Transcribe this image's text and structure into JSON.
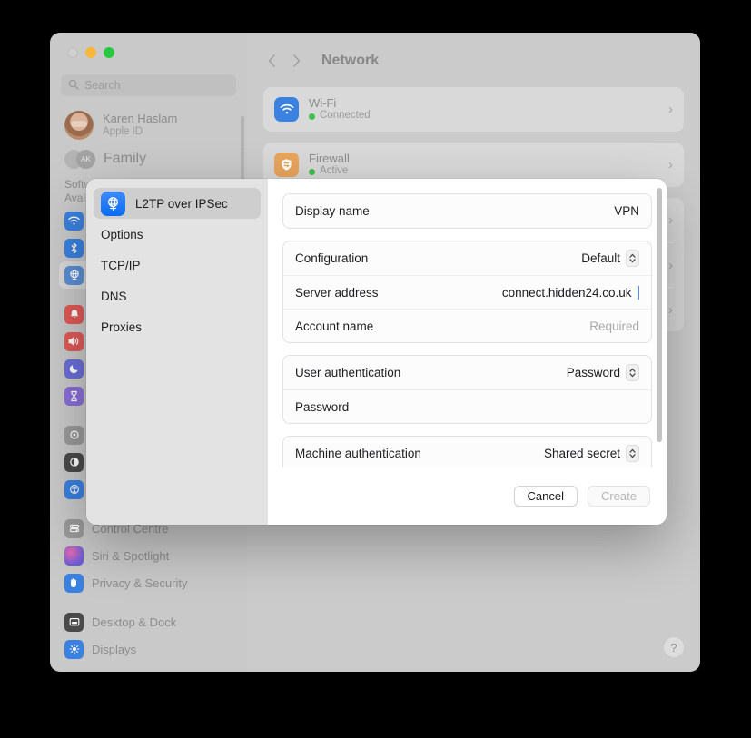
{
  "window": {
    "traffic_lights": [
      "close",
      "minimize",
      "maximize"
    ],
    "sidebar": {
      "search_placeholder": "Search",
      "account": {
        "name": "Karen Haslam",
        "subtitle": "Apple ID"
      },
      "family_label": "Family",
      "family_badge": "AK",
      "software_update_line1": "Software Update",
      "software_update_line2": "Available",
      "items": [
        {
          "label": "Wi-Fi",
          "icon": "wifi-icon",
          "color": "#3b82e0",
          "selected": false
        },
        {
          "label": "Bluetooth",
          "icon": "bluetooth-icon",
          "color": "#3b82e0",
          "selected": false
        },
        {
          "label": "Network",
          "icon": "globe-icon",
          "color": "#5b8fd4",
          "selected": true
        },
        {
          "label": "Notifications",
          "icon": "bell-icon",
          "color": "#e05a57",
          "selected": false
        },
        {
          "label": "Sound",
          "icon": "speaker-icon",
          "color": "#e05a57",
          "selected": false
        },
        {
          "label": "Focus",
          "icon": "moon-icon",
          "color": "#6b6fd8",
          "selected": false
        },
        {
          "label": "Screen Time",
          "icon": "hourglass-icon",
          "color": "#8a6fd8",
          "selected": false
        },
        {
          "label": "General",
          "icon": "gear-icon",
          "color": "#9a9a9a",
          "selected": false
        },
        {
          "label": "Appearance",
          "icon": "contrast-icon",
          "color": "#4a4a4a",
          "selected": false
        },
        {
          "label": "Accessibility",
          "icon": "accessibility-icon",
          "color": "#3b82e0",
          "selected": false
        },
        {
          "label": "Control Centre",
          "icon": "control-centre-icon",
          "color": "#9a9a9a",
          "selected": false
        },
        {
          "label": "Siri & Spotlight",
          "icon": "siri-icon",
          "color": "#c050a0",
          "selected": false
        },
        {
          "label": "Privacy & Security",
          "icon": "hand-icon",
          "color": "#3b82e0",
          "selected": false
        },
        {
          "label": "Desktop & Dock",
          "icon": "desktop-icon",
          "color": "#4a4a4a",
          "selected": false
        },
        {
          "label": "Displays",
          "icon": "display-icon",
          "color": "#3b82e0",
          "selected": false
        }
      ]
    },
    "detail": {
      "title": "Network",
      "back_icon": "chevron-left-icon",
      "forward_icon": "chevron-right-icon",
      "services": [
        {
          "name": "Wi-Fi",
          "status": "Connected",
          "icon": "wifi-icon",
          "color": "#3b82e0",
          "status_color": "#3fbf50"
        },
        {
          "name": "Firewall",
          "status": "Active",
          "icon": "firewall-icon",
          "color": "#e8a55c",
          "status_color": "#3fbf50"
        }
      ],
      "help_label": "?"
    }
  },
  "sheet": {
    "sidebar": {
      "protocol": {
        "label": "L2TP over IPSec",
        "icon": "vpn-globe-icon"
      },
      "items": [
        {
          "label": "Options"
        },
        {
          "label": "TCP/IP"
        },
        {
          "label": "DNS"
        },
        {
          "label": "Proxies"
        }
      ]
    },
    "form": {
      "groups": [
        {
          "rows": [
            {
              "label": "Display name",
              "value": "VPN",
              "type": "text",
              "placeholder": false,
              "caret": false,
              "cursor": false
            }
          ]
        },
        {
          "rows": [
            {
              "label": "Configuration",
              "value": "Default",
              "type": "popup",
              "placeholder": false,
              "caret": true,
              "cursor": false
            },
            {
              "label": "Server address",
              "value": "connect.hidden24.co.uk",
              "type": "text",
              "placeholder": false,
              "caret": false,
              "cursor": true
            },
            {
              "label": "Account name",
              "value": "Required",
              "type": "text",
              "placeholder": true,
              "caret": false,
              "cursor": false
            }
          ]
        },
        {
          "rows": [
            {
              "label": "User authentication",
              "value": "Password",
              "type": "popup",
              "placeholder": false,
              "caret": true,
              "cursor": false
            },
            {
              "label": "Password",
              "value": "",
              "type": "text",
              "placeholder": false,
              "caret": false,
              "cursor": false
            }
          ]
        },
        {
          "rows": [
            {
              "label": "Machine authentication",
              "value": "Shared secret",
              "type": "popup",
              "placeholder": false,
              "caret": true,
              "cursor": false
            }
          ]
        }
      ]
    },
    "footer": {
      "cancel_label": "Cancel",
      "create_label": "Create",
      "create_enabled": false
    }
  }
}
